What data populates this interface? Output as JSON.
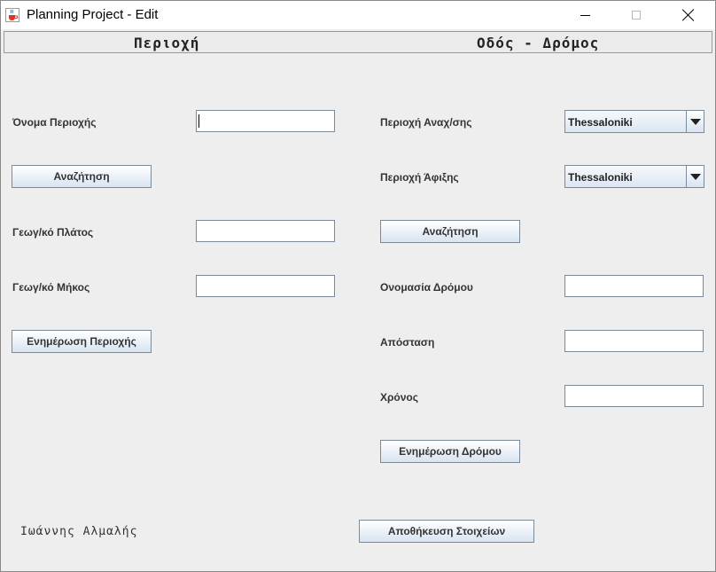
{
  "window": {
    "title": "Planning Project - Edit"
  },
  "header": {
    "left_title": "Περιοχή",
    "right_title": "Οδός - Δρόμος"
  },
  "area": {
    "name_label": "Όνομα Περιοχής",
    "name_value": "",
    "search_button": "Αναζήτηση",
    "lat_label": "Γεωγ/κό Πλάτος",
    "lat_value": "",
    "lon_label": "Γεωγ/κό Μήκος",
    "lon_value": "",
    "update_button": "Ενημέρωση Περιοχής"
  },
  "road": {
    "departure_label": "Περιοχή Αναχ/σης",
    "departure_value": "Thessaloniki",
    "arrival_label": "Περιοχή Άφιξης",
    "arrival_value": "Thessaloniki",
    "search_button": "Αναζήτηση",
    "name_label": "Ονομασία Δρόμου",
    "name_value": "",
    "distance_label": "Απόσταση",
    "distance_value": "",
    "time_label": "Χρόνος",
    "time_value": "",
    "update_button": "Ενημέρωση Δρόμου"
  },
  "footer": {
    "author": "Ιωάννης Αλμαλής",
    "save_button": "Αποθήκευση Στοιχείων"
  }
}
